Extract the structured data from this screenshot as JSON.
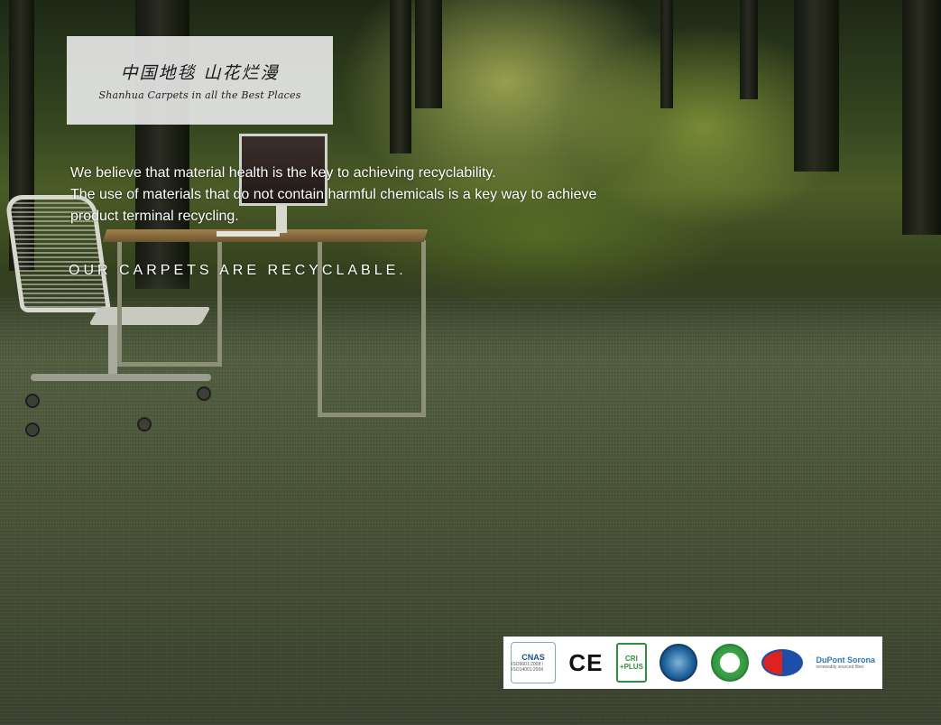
{
  "logo": {
    "chinese": "中国地毯 山花烂漫",
    "english": "Shanhua Carpets in all the Best Places"
  },
  "body_text": {
    "line1": "We believe that material health is the key to achieving recyclability.",
    "line2": "The use of materials that do not contain harmful chemicals is a key way to achieve",
    "line3": "product terminal recycling."
  },
  "headline": "OUR CARPETS ARE RECYCLABLE.",
  "certifications": {
    "cnas": {
      "label": "CNAS",
      "detail": "ISO9001:2008 / ISO14001:2004"
    },
    "ce": {
      "label": "CE"
    },
    "crl": {
      "label": "CRI",
      "detail": "+PLUS"
    },
    "dupont": {
      "label": "DuPont Sorona",
      "detail": "renewably sourced fiber"
    }
  },
  "colors": {
    "forest_highlight": "#dfe87a",
    "carpet": "#4c5639",
    "text": "#ffffff"
  }
}
